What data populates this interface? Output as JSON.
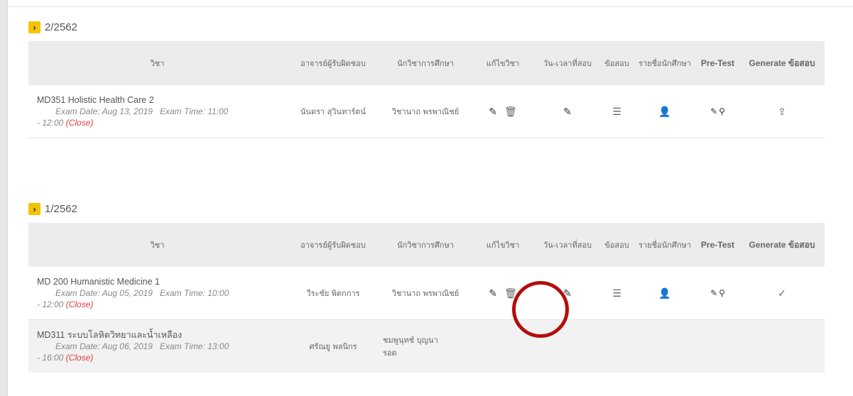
{
  "terms": [
    {
      "label": "2/2562",
      "headers": [
        "วิชา",
        "อาจารย์ผู้รับผิดชอบ",
        "นักวิชาการศึกษา",
        "แก้ไขวิชา",
        "วัน-เวลาที่สอบ",
        "ข้อสอบ",
        "รายชื่อนักศึกษา",
        "Pre-Test",
        "Generate ข้อสอบ"
      ],
      "rows": [
        {
          "course": "MD351 Holistic Health Care 2",
          "exam_date": "Exam Date: Aug 13, 2019",
          "exam_time": "Exam Time: 11:00",
          "exam_end": "- 12:00",
          "status": "(Close)",
          "instructor": "นันดรา สุวินทาร์ตน์",
          "officer": "วิชานาถ พรพาณิชย์",
          "generate_icon": "export-icon"
        }
      ]
    },
    {
      "label": "1/2562",
      "headers": [
        "วิชา",
        "อาจารย์ผู้รับผิดชอบ",
        "นักวิชาการศึกษา",
        "แก้ไขวิชา",
        "วัน-เวลาที่สอบ",
        "ข้อสอบ",
        "รายชื่อนักศึกษา",
        "Pre-Test",
        "Generate ข้อสอบ"
      ],
      "rows": [
        {
          "course": "MD 200 Humanistic Medicine 1",
          "exam_date": "Exam Date: Aug 05, 2019",
          "exam_time": "Exam Time: 10:00",
          "exam_end": "- 12:00",
          "status": "(Close)",
          "instructor": "วีระชัย พิตกการ",
          "officer": "วิชานาถ พรพาณิชย์",
          "generate_icon": "check-icon"
        },
        {
          "course": "MD311 ระบบโลหิตวิทยาและน้ำเหลือง",
          "exam_date": "Exam Date: Aug 06, 2019",
          "exam_time": "Exam Time: 13:00",
          "exam_end": "- 16:00",
          "status": "(Close)",
          "instructor": "ศรัณยู พลนิกร",
          "officer_line1": "ชมพูนุทช์ บุญนา",
          "officer_line2": "รอด"
        }
      ]
    }
  ],
  "icons": {
    "edit": "pencil-icon",
    "delete": "trash-icon",
    "list": "list-icon",
    "students": "user-icon",
    "search": "search-icon"
  },
  "colors": {
    "toggle": "#f5c400",
    "close": "#e23b3b",
    "highlight_circle": "#b30d0d"
  }
}
